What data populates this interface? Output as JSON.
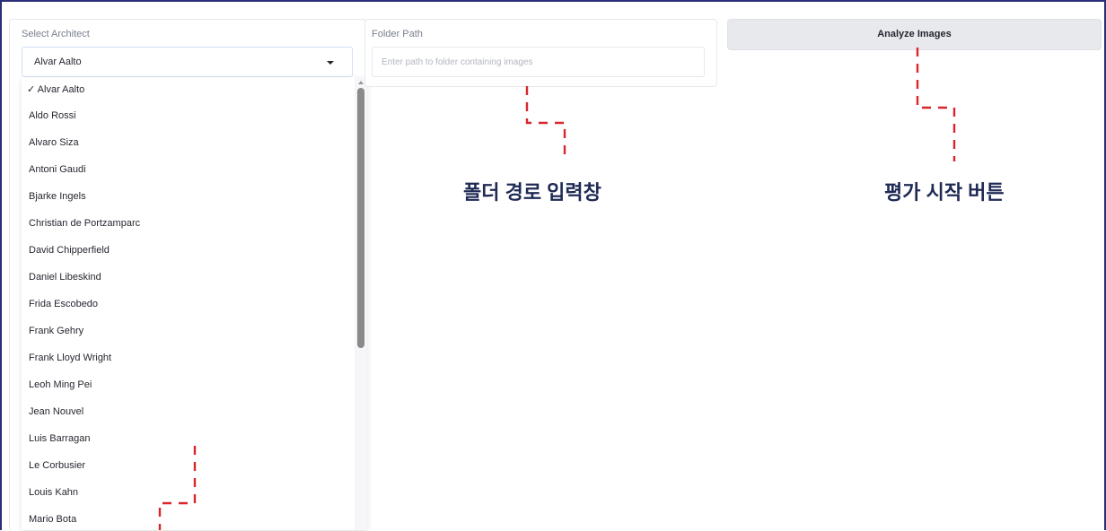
{
  "architect_select": {
    "label": "Select Architect",
    "selected": "Alvar Aalto",
    "options": [
      "✓ Alvar Aalto",
      "Aldo Rossi",
      "Alvaro Siza",
      "Antoni Gaudi",
      "Bjarke Ingels",
      "Christian de Portzamparc",
      "David Chipperfield",
      "Daniel Libeskind",
      "Frida Escobedo",
      "Frank Gehry",
      "Frank Lloyd Wright",
      "Leoh Ming Pei",
      "Jean Nouvel",
      "Luis Barragan",
      "Le Corbusier",
      "Louis Kahn",
      "Mario Bota"
    ]
  },
  "folder_path": {
    "label": "Folder Path",
    "placeholder": "Enter path to folder containing images",
    "value": ""
  },
  "analyze_button": {
    "label": "Analyze Images"
  },
  "annotations": {
    "folder_input": "폴더 경로 입력창",
    "start_button": "평가 시작 버튼"
  },
  "colors": {
    "annotation_line": "#d9262a",
    "frame": "#2b2d7a",
    "button_bg": "#e8e9ed"
  }
}
